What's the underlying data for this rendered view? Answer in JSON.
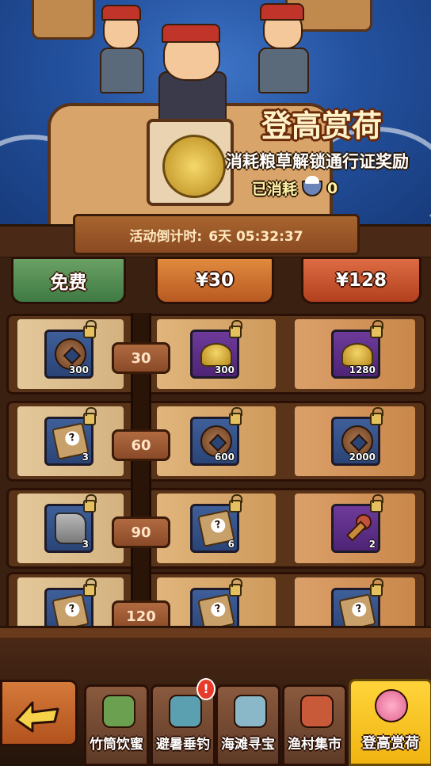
{
  "event": {
    "title": "登高赏荷",
    "subtitle": "消耗粮草解锁通行证奖励",
    "spent_label": "已消耗",
    "spent_value": "0",
    "countdown_label": "活动倒计时:",
    "countdown_value": "6天 05:32:37"
  },
  "tracks": {
    "free_label": "免费",
    "tier1_label": "¥30",
    "tier2_label": "¥128"
  },
  "rows": [
    {
      "level": "30",
      "free": {
        "icon": "coin-icon",
        "qty": "300"
      },
      "tier1": {
        "icon": "gold-ingot-icon",
        "qty": "300"
      },
      "tier2": {
        "icon": "gold-ingot-icon",
        "qty": "1280"
      }
    },
    {
      "level": "60",
      "free": {
        "icon": "mystery-scroll-icon",
        "qty": "3"
      },
      "tier1": {
        "icon": "coin-icon",
        "qty": "600"
      },
      "tier2": {
        "icon": "coin-icon",
        "qty": "2000"
      }
    },
    {
      "level": "90",
      "free": {
        "icon": "stone-icon",
        "qty": "3"
      },
      "tier1": {
        "icon": "mystery-scroll-icon",
        "qty": "6"
      },
      "tier2": {
        "icon": "key-icon",
        "qty": "2"
      }
    },
    {
      "level": "120",
      "free": {
        "icon": "mystery-scroll-icon",
        "qty": ""
      },
      "tier1": {
        "icon": "mystery-scroll-icon",
        "qty": ""
      },
      "tier2": {
        "icon": "mystery-scroll-icon",
        "qty": ""
      }
    }
  ],
  "nav": {
    "back_icon": "back-arrow-icon",
    "tabs": [
      {
        "label": "竹筒饮蜜",
        "icon": "bamboo-honey-icon"
      },
      {
        "label": "避暑垂钓",
        "icon": "fishing-icon",
        "badge": "!"
      },
      {
        "label": "海滩寻宝",
        "icon": "shell-pearl-icon"
      },
      {
        "label": "渔村集市",
        "icon": "market-icon"
      },
      {
        "label": "登高赏荷",
        "icon": "lotus-icon",
        "active": true
      }
    ]
  },
  "colors": {
    "free_header": "#4f8a52",
    "tier1_header": "#cc7030",
    "tier2_header": "#c8502a",
    "active_tab": "#f6c21e",
    "sea": "#2452a0"
  }
}
